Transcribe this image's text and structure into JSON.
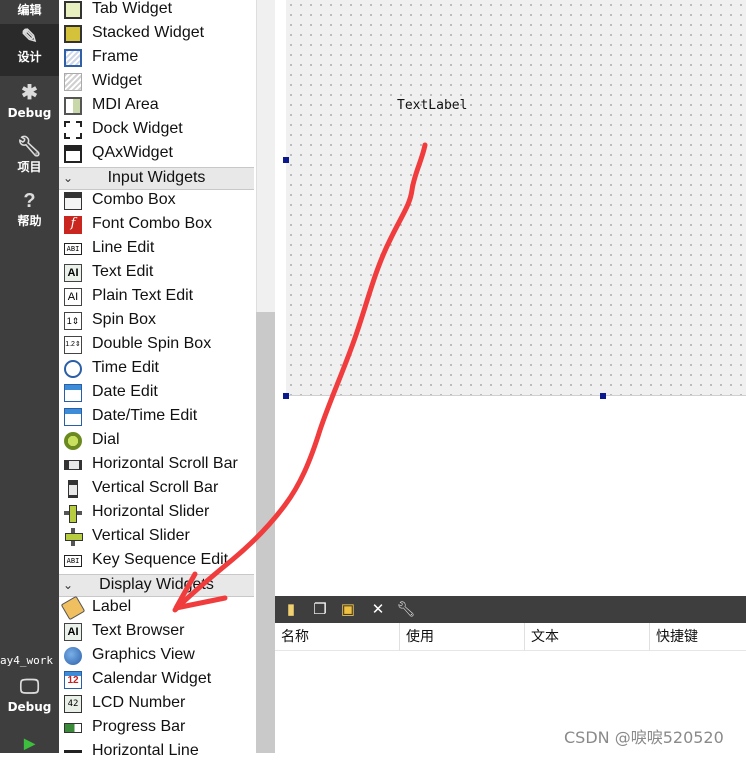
{
  "sidebar": {
    "items": [
      {
        "label": "编辑",
        "icon": "edit-icon"
      },
      {
        "label": "设计",
        "icon": "pencil-icon"
      },
      {
        "label": "Debug",
        "icon": "bug-icon"
      },
      {
        "label": "项目",
        "icon": "wrench-icon"
      },
      {
        "label": "帮助",
        "icon": "help-icon"
      }
    ],
    "project_name": "ay4_work",
    "bottom": {
      "label": "Debug",
      "icon": "monitor-icon"
    }
  },
  "widget_box": {
    "containers": [
      {
        "label": "Tab Widget",
        "icon": "tab-widget-icon"
      },
      {
        "label": "Stacked Widget",
        "icon": "stacked-widget-icon"
      },
      {
        "label": "Frame",
        "icon": "frame-icon"
      },
      {
        "label": "Widget",
        "icon": "widget-icon"
      },
      {
        "label": "MDI Area",
        "icon": "mdi-area-icon"
      },
      {
        "label": "Dock Widget",
        "icon": "dock-widget-icon"
      },
      {
        "label": "QAxWidget",
        "icon": "qaxwidget-icon"
      }
    ],
    "input_category": "Input Widgets",
    "inputs": [
      {
        "label": "Combo Box",
        "icon": "combo-box-icon"
      },
      {
        "label": "Font Combo Box",
        "icon": "font-combo-box-icon"
      },
      {
        "label": "Line Edit",
        "icon": "line-edit-icon"
      },
      {
        "label": "Text Edit",
        "icon": "text-edit-icon"
      },
      {
        "label": "Plain Text Edit",
        "icon": "plain-text-edit-icon"
      },
      {
        "label": "Spin Box",
        "icon": "spin-box-icon"
      },
      {
        "label": "Double Spin Box",
        "icon": "double-spin-box-icon"
      },
      {
        "label": "Time Edit",
        "icon": "time-edit-icon"
      },
      {
        "label": "Date Edit",
        "icon": "date-edit-icon"
      },
      {
        "label": "Date/Time Edit",
        "icon": "datetime-edit-icon"
      },
      {
        "label": "Dial",
        "icon": "dial-icon"
      },
      {
        "label": "Horizontal Scroll Bar",
        "icon": "horizontal-scroll-bar-icon"
      },
      {
        "label": "Vertical Scroll Bar",
        "icon": "vertical-scroll-bar-icon"
      },
      {
        "label": "Horizontal Slider",
        "icon": "horizontal-slider-icon"
      },
      {
        "label": "Vertical Slider",
        "icon": "vertical-slider-icon"
      },
      {
        "label": "Key Sequence Edit",
        "icon": "key-sequence-edit-icon"
      }
    ],
    "display_category": "Display Widgets",
    "displays": [
      {
        "label": "Label",
        "icon": "label-icon"
      },
      {
        "label": "Text Browser",
        "icon": "text-browser-icon"
      },
      {
        "label": "Graphics View",
        "icon": "graphics-view-icon"
      },
      {
        "label": "Calendar Widget",
        "icon": "calendar-widget-icon"
      },
      {
        "label": "LCD Number",
        "icon": "lcd-number-icon"
      },
      {
        "label": "Progress Bar",
        "icon": "progress-bar-icon"
      },
      {
        "label": "Horizontal Line",
        "icon": "horizontal-line-icon"
      }
    ]
  },
  "form": {
    "text_label": "TextLabel"
  },
  "action_editor": {
    "toolbar_icons": [
      "new-action-icon",
      "copy-action-icon",
      "paste-action-icon",
      "delete-action-icon",
      "configure-icon"
    ],
    "columns": [
      "名称",
      "使用",
      "文本",
      "快捷键"
    ]
  },
  "watermark": "CSDN @唳唳520520",
  "colors": {
    "sidebar_bg": "#3e3e3e",
    "arrow": "#f03c3c",
    "handle": "#0a1a8c"
  }
}
